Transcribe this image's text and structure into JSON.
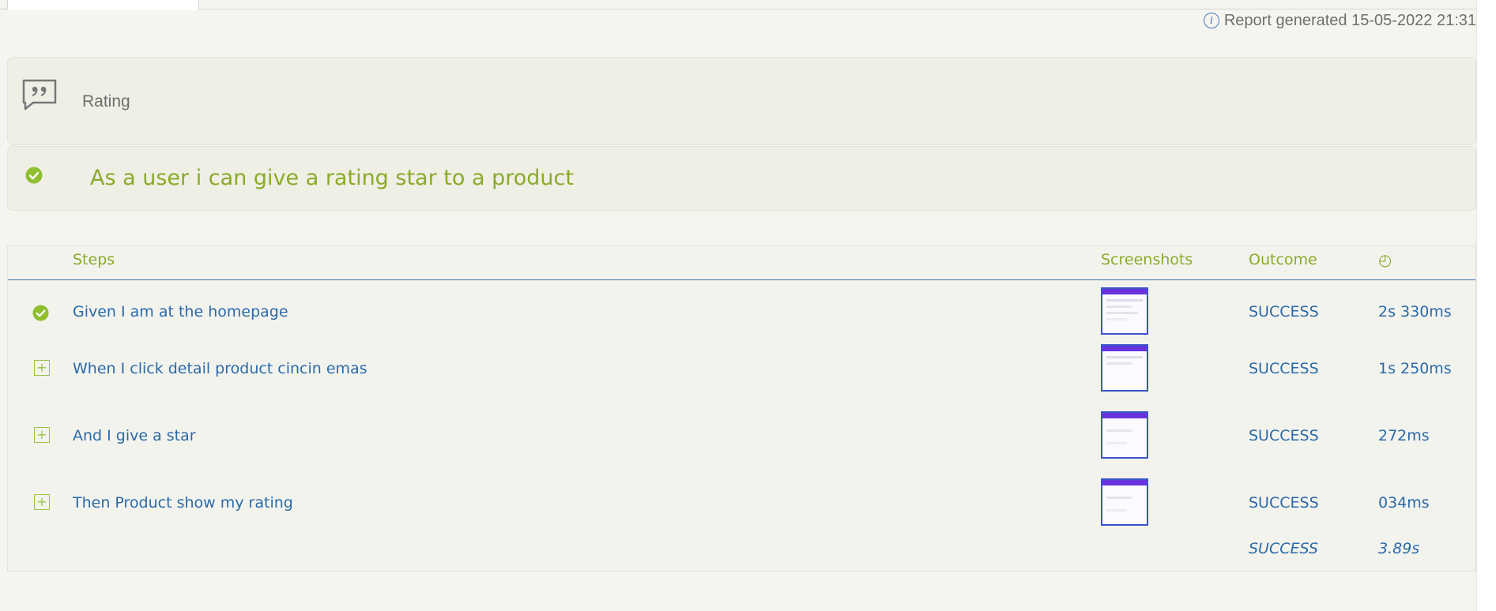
{
  "header": {
    "report_generated": "Report generated 15-05-2022 21:31",
    "info_icon": "i"
  },
  "feature": {
    "icon": "quote-bubble-icon",
    "label": "Rating"
  },
  "scenario": {
    "status_icon": "check-circle-icon",
    "title": "As a user i can give a rating star to a product"
  },
  "table": {
    "headers": {
      "steps": "Steps",
      "screenshots": "Screenshots",
      "outcome": "Outcome",
      "duration_icon": "◴"
    },
    "rows": [
      {
        "icon": "check-circle-icon",
        "step": "Given I am at the homepage",
        "outcome": "SUCCESS",
        "duration": "2s 330ms"
      },
      {
        "icon": "expand-plus-icon",
        "expand_glyph": "+",
        "step": "When I click detail product cincin emas",
        "outcome": "SUCCESS",
        "duration": "1s 250ms"
      },
      {
        "icon": "expand-plus-icon",
        "expand_glyph": "+",
        "step": "And I give a star",
        "outcome": "SUCCESS",
        "duration": "272ms"
      },
      {
        "icon": "expand-plus-icon",
        "expand_glyph": "+",
        "step": "Then Product show my rating",
        "outcome": "SUCCESS",
        "duration": "034ms"
      }
    ],
    "total": {
      "outcome": "SUCCESS",
      "duration": "3.89s"
    }
  },
  "colors": {
    "accent_green": "#8aaa28",
    "link_blue": "#2a6aa8",
    "header_line": "#3a6ea5",
    "panel_bg": "#efefe6"
  }
}
